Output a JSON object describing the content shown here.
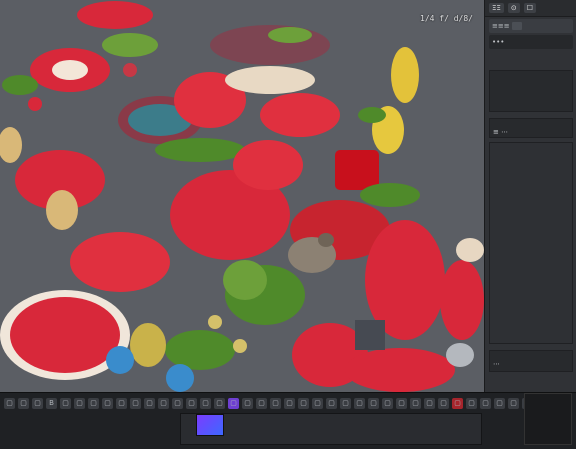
{
  "canvas": {
    "overlay_title": "1/4 f/ d/8/"
  },
  "panel": {
    "top_chips": [
      "ΞΞ",
      "⊙",
      "☐"
    ],
    "rows": [
      "≡≡≡",
      "•••",
      "≡ ⋯",
      "⋯"
    ]
  },
  "toolbar": {
    "icons_row1": [
      "▢",
      "▢",
      "▢",
      "B",
      "▢",
      "▢",
      "▢",
      "▢",
      "▢",
      "▢",
      "▢",
      "▢",
      "▢",
      "▢",
      "▢",
      "▢",
      "▢",
      "▢",
      "▢",
      "▢",
      "▢",
      "▢",
      "▢",
      "▢",
      "▢",
      "▢",
      "▢",
      "▢",
      "▢",
      "▢",
      "▢",
      "▢",
      "▢",
      "▢",
      "▢",
      "▢",
      "▢",
      "▢",
      "▢",
      "▢"
    ],
    "status_left": "",
    "status_right": ""
  },
  "colors": {
    "accent": "#6e3fd1",
    "embroidery_red": "#d8283a",
    "embroidery_green": "#4f8a2a"
  }
}
